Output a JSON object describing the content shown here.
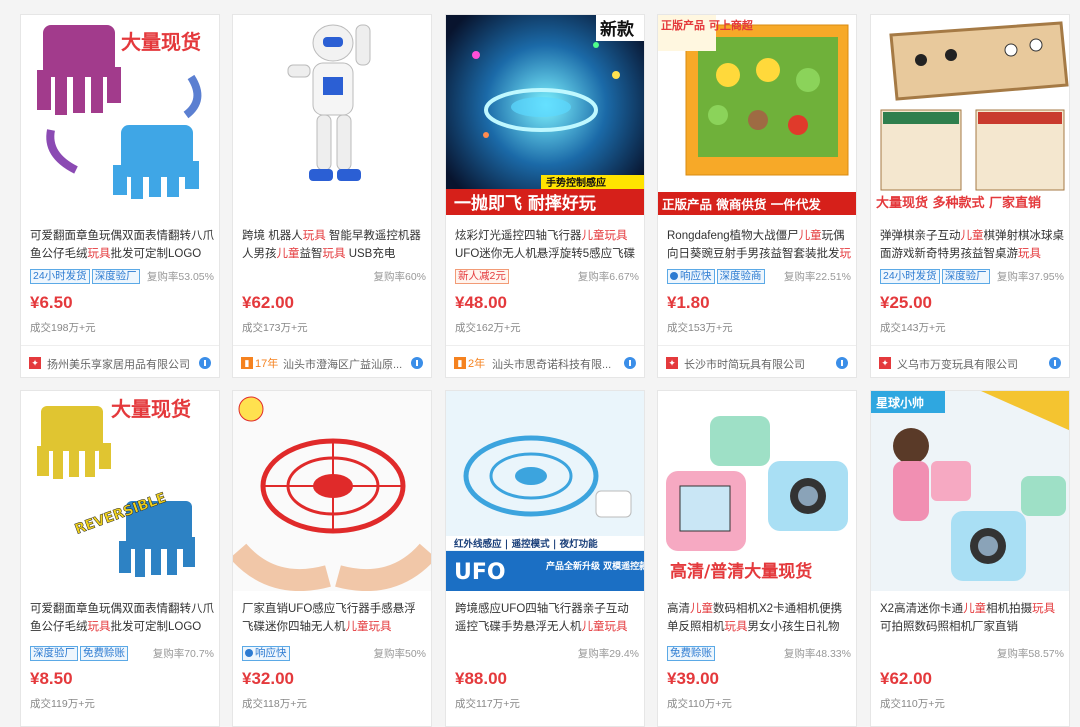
{
  "products": [
    {
      "title_pre": "可爱翻面章鱼玩偶双面表情翻转八爪鱼公仔毛绒",
      "title_hl": "玩具",
      "title_post": "批发可定制LOGO",
      "tags": [
        {
          "text": "24小时发货",
          "style": "blue"
        },
        {
          "text": "深度验厂",
          "style": "blue"
        }
      ],
      "rate": "复购率53.05%",
      "price": "¥6.50",
      "sold": "成交198万+元",
      "supplier": {
        "years": "",
        "name": "扬州美乐享家居用品有限公司",
        "logo_color": "#e4393c"
      },
      "image": {
        "overlay_text": "大量现货",
        "icon": "octopus-plush-image"
      }
    },
    {
      "title_pre": "跨境 机器人",
      "title_hl": "玩具",
      "title_post": " 智能早教遥控机器人男孩",
      "title_hl2": "儿童",
      "title_post2": "益智",
      "title_hl3": "玩具",
      "title_post3": " USB充电",
      "tags": [],
      "rate": "复购率60%",
      "price": "¥62.00",
      "sold": "成交173万+元",
      "supplier": {
        "years": "17年",
        "name": "汕头市澄海区广益汕原...",
        "logo_color": "#f5821f"
      },
      "image": {
        "overlay_text": "",
        "icon": "robot-toy-image"
      }
    },
    {
      "title_pre": "炫彩灯光遥控四轴飞行器",
      "title_hl": "儿童玩具",
      "title_post": "UFO迷你无人机悬浮旋转5感应飞碟",
      "tags": [
        {
          "text": "新人减2元",
          "style": "red"
        }
      ],
      "rate": "复购率6.67%",
      "price": "¥48.00",
      "sold": "成交162万+元",
      "supplier": {
        "years": "2年",
        "name": "汕头市思奇诺科技有限...",
        "logo_color": "#f5821f"
      },
      "image": {
        "overlay_text": "新款",
        "banner_text": "一抛即飞 耐摔好玩",
        "sub_text": "手势控制感应",
        "icon": "ufo-drone-image"
      }
    },
    {
      "title_pre": "Rongdafeng植物大战僵尸",
      "title_hl": "儿童",
      "title_post": "玩偶向日葵豌豆射手男孩益智套装批发",
      "title_hl2": "玩具",
      "tags": [
        {
          "text": "响应快",
          "style": "dot"
        },
        {
          "text": "深度验商",
          "style": "blue"
        }
      ],
      "rate": "复购率22.51%",
      "price": "¥1.80",
      "sold": "成交153万+元",
      "supplier": {
        "years": "",
        "name": "长沙市时简玩具有限公司",
        "logo_color": "#e4393c"
      },
      "image": {
        "overlay_text": "正版产品 可上商超",
        "banner_text": "正版产品 微商供货 一件代发",
        "icon": "plants-zombies-set-image"
      }
    },
    {
      "title_pre": "弹弹棋亲子互动",
      "title_hl": "儿童",
      "title_post": "棋弹射棋冰球桌面游戏新奇特男孩益智桌游",
      "title_hl2": "玩具",
      "tags": [
        {
          "text": "24小时发货",
          "style": "blue"
        },
        {
          "text": "深度验厂",
          "style": "blue"
        }
      ],
      "rate": "复购率37.95%",
      "price": "¥25.00",
      "sold": "成交143万+元",
      "supplier": {
        "years": "",
        "name": "义乌市万变玩具有限公司",
        "logo_color": "#e4393c"
      },
      "image": {
        "overlay_text": "大量现货 多种款式 厂家直销",
        "icon": "sling-board-game-image"
      }
    },
    {
      "title_pre": "可爱翻面章鱼玩偶双面表情翻转八爪鱼公仔毛绒",
      "title_hl": "玩具",
      "title_post": "批发可定制LOGO",
      "tags": [
        {
          "text": "深度验厂",
          "style": "blue"
        },
        {
          "text": "免费赊账",
          "style": "blue"
        }
      ],
      "rate": "复购率70.7%",
      "price": "¥8.50",
      "sold": "成交119万+元",
      "image": {
        "overlay_text": "大量现货",
        "sub_text": "REVERSIBLE",
        "icon": "octopus-plush-image"
      }
    },
    {
      "title_pre": "厂家直销UFO感应飞行器手感悬浮飞碟迷你四轴无人机",
      "title_hl": "儿童玩具",
      "title_post": "",
      "tags": [
        {
          "text": "响应快",
          "style": "dot"
        }
      ],
      "rate": "复购率50%",
      "price": "¥32.00",
      "sold": "成交118万+元",
      "image": {
        "overlay_text": "",
        "icon": "red-ufo-drone-image"
      }
    },
    {
      "title_pre": "跨境感应UFO四轴飞行器亲子互动遥控飞碟手势悬浮无人机",
      "title_hl": "儿童玩具",
      "title_post": "",
      "tags": [],
      "rate": "复购率29.4%",
      "price": "¥88.00",
      "sold": "成交117万+元",
      "image": {
        "overlay_text": "UFO",
        "banner_text": "红外线感应 | 遥控模式 | 夜灯功能",
        "sub_text": "产品全新升级 双模遥控款",
        "icon": "blue-ufo-drone-image"
      }
    },
    {
      "title_pre": "高清",
      "title_hl": "儿童",
      "title_post": "数码相机X2卡通相机便携单反照相机",
      "title_hl2": "玩具",
      "title_post2": "男女小孩生日礼物",
      "tags": [
        {
          "text": "免费赊账",
          "style": "blue"
        }
      ],
      "rate": "复购率48.33%",
      "price": "¥39.00",
      "sold": "成交110万+元",
      "image": {
        "overlay_text": "高清/普清大量现货",
        "icon": "kids-camera-image"
      }
    },
    {
      "title_pre": "X2高清迷你卡通",
      "title_hl": "儿童",
      "title_post": "相机拍摄",
      "title_hl2": "玩具",
      "title_post2": "可拍照数码照相机厂家直销",
      "tags": [],
      "rate": "复购率58.57%",
      "price": "¥62.00",
      "sold": "成交110万+元",
      "image": {
        "overlay_text": "星球小帅",
        "icon": "kids-camera-girl-image"
      }
    }
  ],
  "colors": {
    "price": "#e4393c",
    "tag_blue": "#2d7bd1",
    "brand": "#f5821f"
  }
}
